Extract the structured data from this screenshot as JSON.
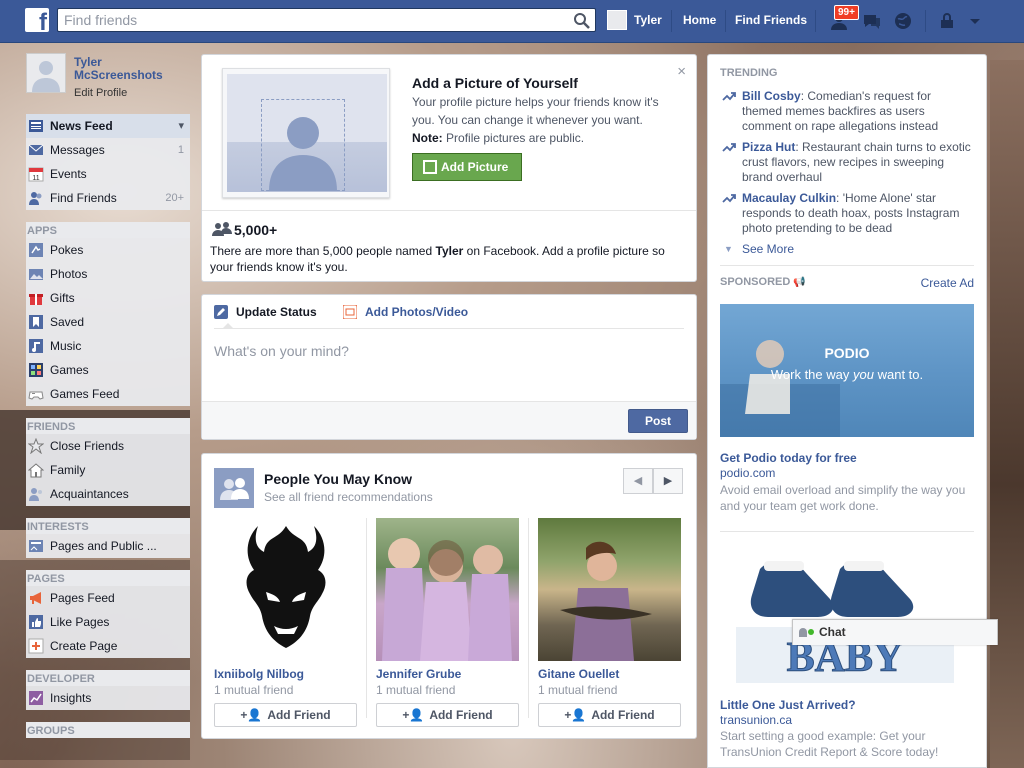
{
  "topbar": {
    "logo_glyph": "f",
    "search_placeholder": "Find friends",
    "user_name": "Tyler",
    "home": "Home",
    "find_friends": "Find Friends",
    "notif_badge": "99+"
  },
  "sidebar": {
    "profile_name": "Tyler McScreenshots",
    "edit_profile": "Edit Profile",
    "favorites": [
      {
        "label": "News Feed",
        "count": ""
      },
      {
        "label": "Messages",
        "count": "1"
      },
      {
        "label": "Events",
        "count": ""
      },
      {
        "label": "Find Friends",
        "count": "20+"
      }
    ],
    "apps_title": "APPS",
    "apps": [
      "Pokes",
      "Photos",
      "Gifts",
      "Saved",
      "Music",
      "Games",
      "Games Feed"
    ],
    "friends_title": "FRIENDS",
    "friends": [
      "Close Friends",
      "Family",
      "Acquaintances"
    ],
    "interests_title": "INTERESTS",
    "interests": [
      "Pages and Public ..."
    ],
    "pages_title": "PAGES",
    "pages": [
      "Pages Feed",
      "Like Pages",
      "Create Page"
    ],
    "developer_title": "DEVELOPER",
    "developer": [
      "Insights"
    ],
    "groups_title": "GROUPS"
  },
  "promo": {
    "title": "Add a Picture of Yourself",
    "text": "Your profile picture helps your friends know it's you. You can change it whenever you want.",
    "note_label": "Note:",
    "note_text": "Profile pictures are public.",
    "button": "Add Picture",
    "close": "×",
    "count": "5,000+",
    "count_text_1": "There are more than 5,000 people named",
    "count_name": "Tyler",
    "count_text_2": "on Facebook. Add a profile picture so your friends know it's you."
  },
  "composer": {
    "tab_status": "Update Status",
    "tab_photos": "Add Photos/Video",
    "placeholder": "What's on your mind?",
    "post": "Post"
  },
  "pymk": {
    "title": "People You May Know",
    "subtitle": "See all friend recommendations",
    "add_label": "Add Friend",
    "people": [
      {
        "name": "Ixniibolg Nilbog",
        "mutual": "1 mutual friend"
      },
      {
        "name": "Jennifer Grube",
        "mutual": "1 mutual friend"
      },
      {
        "name": "Gitane Ouellet",
        "mutual": "1 mutual friend"
      }
    ]
  },
  "trending": {
    "title": "TRENDING",
    "items": [
      {
        "name": "Bill Cosby",
        "text": ": Comedian's request for themed memes backfires as users comment on rape allegations instead"
      },
      {
        "name": "Pizza Hut",
        "text": ": Restaurant chain turns to exotic crust flavors, new recipes in sweeping brand overhaul"
      },
      {
        "name": "Macaulay Culkin",
        "text": ": 'Home Alone' star responds to death hoax, posts Instagram photo pretending to be dead"
      }
    ],
    "see_more": "See More"
  },
  "sponsored": {
    "title": "SPONSORED",
    "create_ad": "Create Ad",
    "ads": [
      {
        "brand": "PODIO",
        "tagline_1": "Work the way",
        "tagline_em": "you",
        "tagline_2": "want to.",
        "title": "Get Podio today for free",
        "domain": "podio.com",
        "text": "Avoid email overload and simplify the way you and your team get work done."
      },
      {
        "image_text": "BABY",
        "title": "Little One Just Arrived?",
        "domain": "transunion.ca",
        "text": "Start setting a good example: Get your TransUnion Credit Report & Score today!"
      }
    ]
  },
  "chat": {
    "label": "Chat"
  },
  "colors": {
    "brand": "#3b5998",
    "green": "#69a74e",
    "badge": "#f03d25"
  }
}
